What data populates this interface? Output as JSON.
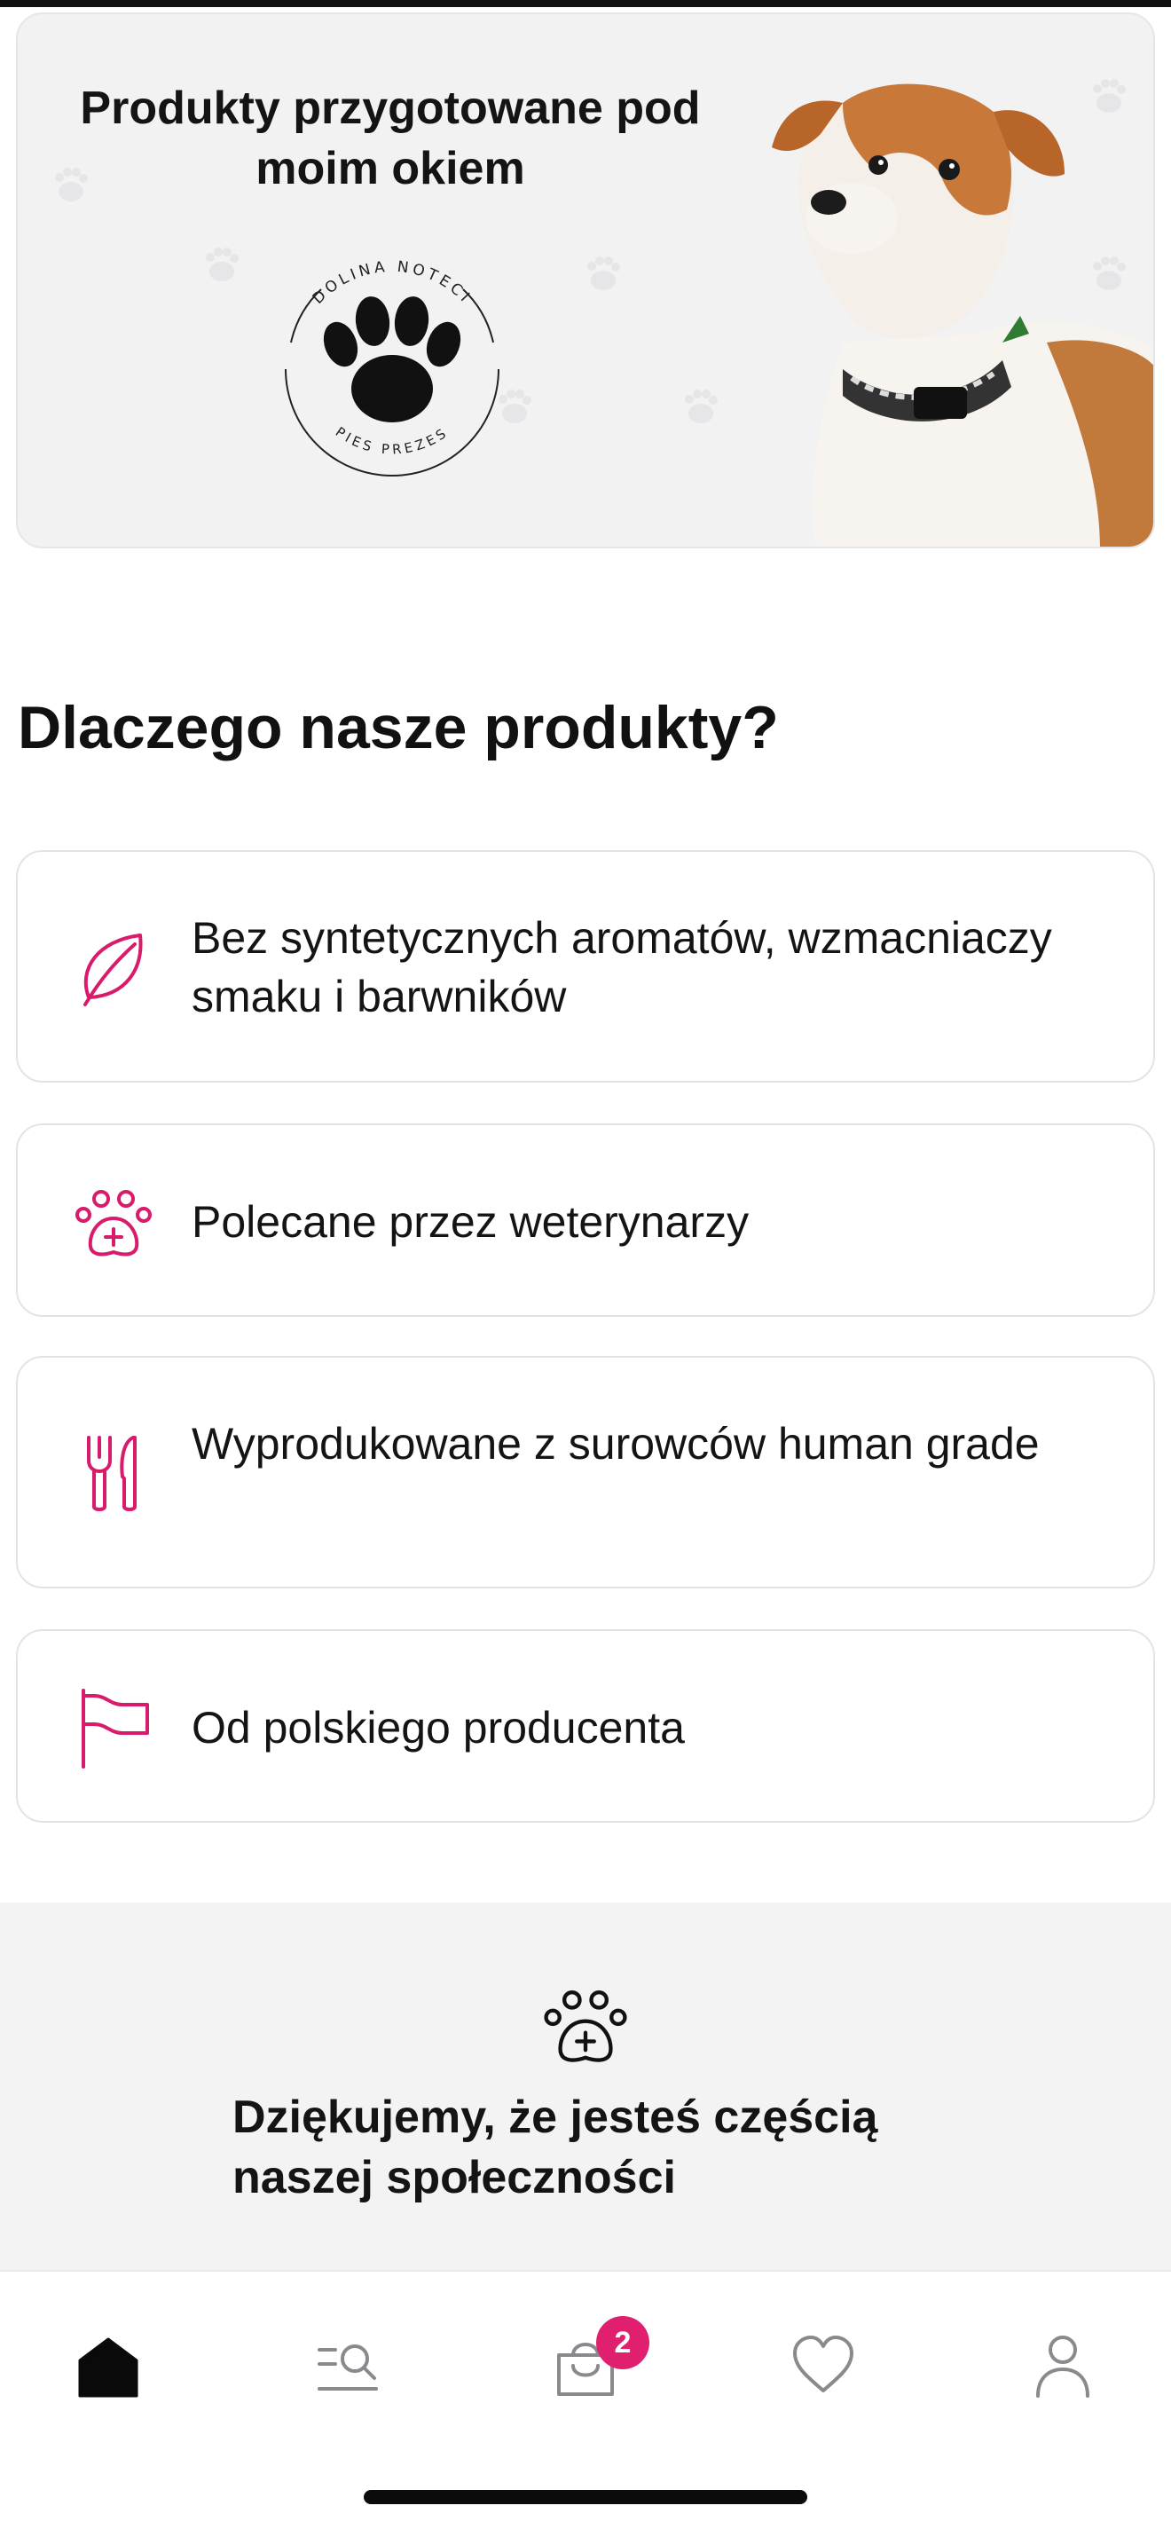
{
  "banner": {
    "title": "Produkty przygotowane pod moim okiem",
    "logo": {
      "top_text": "DOLINA NOTECI",
      "bottom_text": "PIES PREZES",
      "icon": "paw-icon"
    },
    "image": "dog-photo"
  },
  "section": {
    "heading": "Dlaczego nasze produkty?"
  },
  "features": [
    {
      "icon": "leaf-icon",
      "text": "Bez syntetycznych aromatów, wzmacniaczy smaku i barwników"
    },
    {
      "icon": "paw-plus-icon",
      "text": "Polecane przez weterynarzy"
    },
    {
      "icon": "fork-knife-icon",
      "text": "Wyprodukowane z surowców human grade"
    },
    {
      "icon": "flag-icon",
      "text": "Od polskiego producenta"
    }
  ],
  "community": {
    "icon": "paw-plus-icon",
    "text": "Dziękujemy, że jesteś częścią naszej społeczności"
  },
  "nav": {
    "items": [
      {
        "icon": "home-icon",
        "active": true
      },
      {
        "icon": "search-list-icon",
        "active": false
      },
      {
        "icon": "cart-icon",
        "active": false,
        "badge": "2"
      },
      {
        "icon": "heart-icon",
        "active": false
      },
      {
        "icon": "user-icon",
        "active": false
      }
    ]
  },
  "colors": {
    "accent": "#d81b6a",
    "badge": "#e0206f",
    "text": "#111111",
    "muted_icon": "#8a8a8e",
    "banner_bg": "#f2f2f3",
    "community_bg": "#f3f3f4"
  }
}
